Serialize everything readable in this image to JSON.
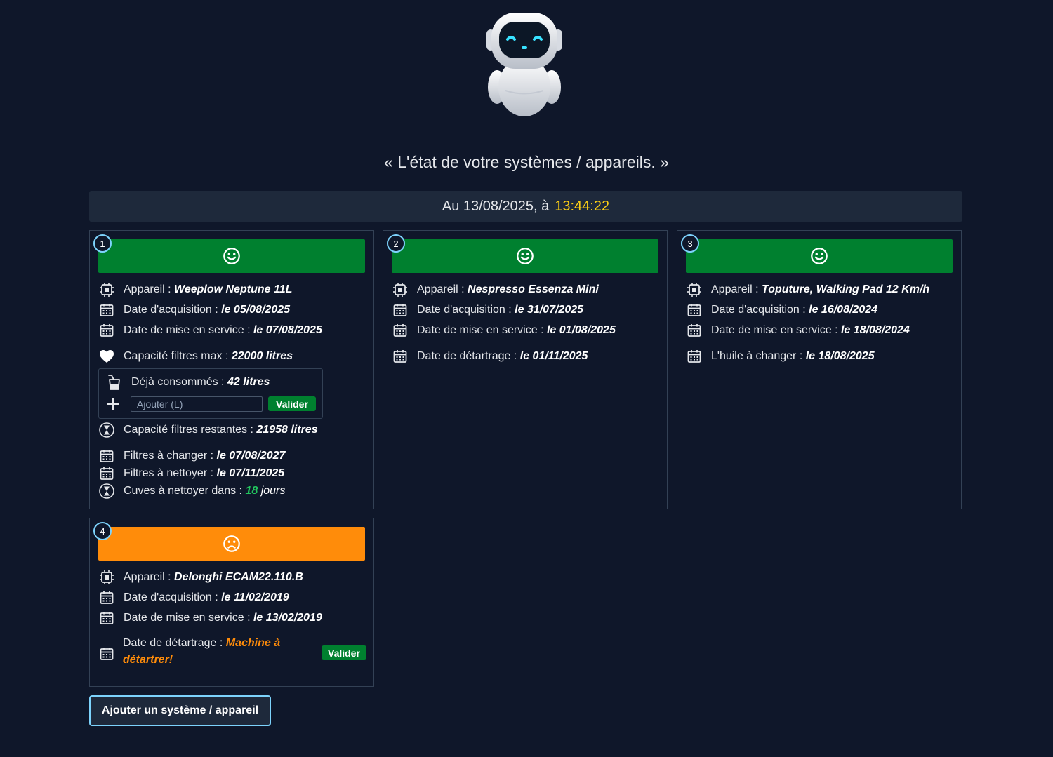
{
  "header": {
    "subtitle": "« L'état de votre systèmes / appareils. »",
    "date_prefix": "Au 13/08/2025, à",
    "time": "13:44:22"
  },
  "colors": {
    "background": "#0f172a",
    "status_good": "#00802f",
    "status_warn": "#ff8c0a",
    "time_accent": "#facc15",
    "badge_border": "#7dd3fc"
  },
  "cards": [
    {
      "number": "1",
      "status": "happy",
      "device_label": "Appareil :",
      "device": "Weeplow Neptune 11L",
      "acq_label": "Date d'acquisition :",
      "acq": "le 05/08/2025",
      "service_label": "Date de mise en service :",
      "service": "le 07/08/2025",
      "capacity_label": "Capacité filtres max :",
      "capacity": "22000 litres",
      "consumed_label": "Déjà consommés :",
      "consumed": "42 litres",
      "add_placeholder": "Ajouter (L)",
      "validate_label": "Valider",
      "remaining_label": "Capacité filtres restantes :",
      "remaining": "21958 litres",
      "change_label": "Filtres à changer :",
      "change": "le 07/08/2027",
      "clean_label": "Filtres à nettoyer :",
      "clean": "le 07/11/2025",
      "tanks_label": "Cuves à nettoyer dans :",
      "tanks_days": "18",
      "tanks_unit": "jours"
    },
    {
      "number": "2",
      "status": "happy",
      "device_label": "Appareil :",
      "device": "Nespresso Essenza Mini",
      "acq_label": "Date d'acquisition :",
      "acq": "le 31/07/2025",
      "service_label": "Date de mise en service :",
      "service": "le 01/08/2025",
      "descale_label": "Date de détartrage :",
      "descale": "le 01/11/2025"
    },
    {
      "number": "3",
      "status": "happy",
      "device_label": "Appareil :",
      "device": "Toputure, Walking Pad 12 Km/h",
      "acq_label": "Date d'acquisition :",
      "acq": "le 16/08/2024",
      "service_label": "Date de mise en service :",
      "service": "le 18/08/2024",
      "oil_label": "L'huile à changer :",
      "oil": "le 18/08/2025"
    },
    {
      "number": "4",
      "status": "sad",
      "device_label": "Appareil :",
      "device": "Delonghi ECAM22.110.B",
      "acq_label": "Date d'acquisition :",
      "acq": "le 11/02/2019",
      "service_label": "Date de mise en service :",
      "service": "le 13/02/2019",
      "descale_label": "Date de détartrage :",
      "descale_line1": "Machine à",
      "descale_line2": "détartrer!",
      "validate_label": "Valider"
    }
  ],
  "footer": {
    "add_button": "Ajouter un système / appareil"
  }
}
